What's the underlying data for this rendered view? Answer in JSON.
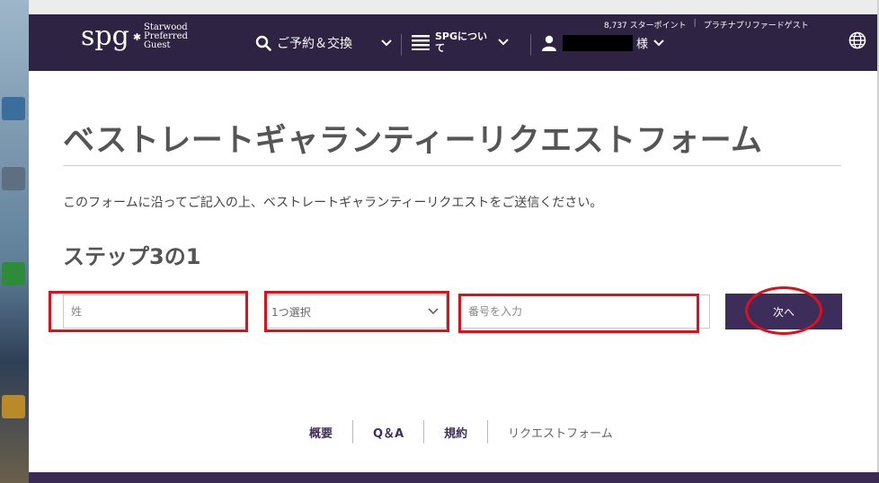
{
  "header": {
    "logo_mark": "spg",
    "logo_line1": "Starwood",
    "logo_line2": "Preferred",
    "logo_line3": "Guest",
    "points": "8,737 スターポイント",
    "divider": "|",
    "tier": "プラチナプリファードゲスト",
    "nav_reserve": "ご予約＆交換",
    "nav_about": "SPGについて",
    "user_suffix": "様"
  },
  "main": {
    "title": "ベストレートギャランティーリクエストフォーム",
    "intro": "このフォームに沿ってご記入の上、ベストレートギャランティーリクエストをご送信ください。",
    "step": "ステップ3の1",
    "lastname_placeholder": "姓",
    "select_value": "1つ選択",
    "number_placeholder": "番号を入力",
    "next_label": "次へ"
  },
  "footer": {
    "links": [
      "概要",
      "Q＆A",
      "規約"
    ],
    "current": "リクエストフォーム"
  },
  "colors": {
    "header_bg": "#2e2342",
    "button_bg": "#3d2d5a",
    "annotation": "#e0101a"
  },
  "icons": {
    "search": "search-icon",
    "menu": "menu-icon",
    "user": "user-icon",
    "globe": "globe-icon",
    "chevron": "chevron-down-icon"
  }
}
